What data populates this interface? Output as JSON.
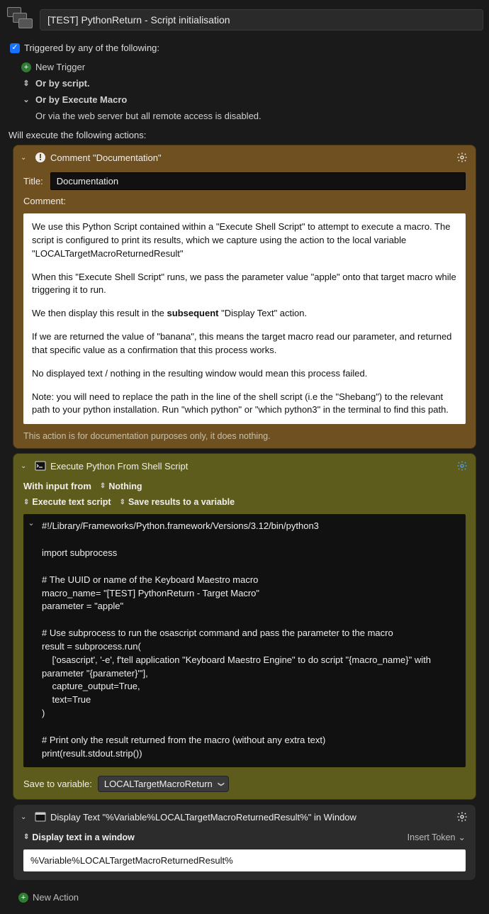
{
  "header": {
    "title": "[TEST] PythonReturn - Script initialisation"
  },
  "triggers": {
    "label": "Triggered by any of the following:",
    "new_trigger": "New Trigger",
    "or_script": "Or by script.",
    "or_execute_macro": "Or by Execute Macro",
    "or_web": "Or via the web server but all remote access is disabled."
  },
  "actions_label": "Will execute the following actions:",
  "comment_action": {
    "header": "Comment \"Documentation\"",
    "title_label": "Title:",
    "title_value": "Documentation",
    "comment_label": "Comment:",
    "p1": "We use this Python Script contained within a \"Execute Shell Script\" to attempt to execute a macro. The script is configured to print its results, which we capture using the action to the local variable \"LOCALTargetMacroReturnedResult\"",
    "p2": "When this \"Execute Shell Script\" runs, we pass the parameter value \"apple\" onto that target macro while triggering it to run.",
    "p3_a": "We then display this result in the ",
    "p3_b": "subsequent",
    "p3_c": " \"Display Text\" action.",
    "p4": "If we are returned the value of \"banana\", this means the target macro read our parameter, and returned that specific value as a confirmation that this process works.",
    "p5": "No displayed text / nothing in the resulting window would mean this process failed.",
    "p6": "Note: you will need to replace the path in the line of the shell script (i.e the \"Shebang\") to the relevant path to your python installation. Run \"which python\" or \"which python3\" in the terminal to find this path.",
    "footer_note": "This action is for documentation purposes only, it does nothing."
  },
  "exec_action": {
    "header": "Execute Python From Shell Script",
    "input_label": "With input from",
    "input_value": "Nothing",
    "opt_exec": "Execute text script",
    "opt_save": "Save results to a variable",
    "script": "#!/Library/Frameworks/Python.framework/Versions/3.12/bin/python3\n\nimport subprocess\n\n# The UUID or name of the Keyboard Maestro macro\nmacro_name= \"[TEST] PythonReturn - Target Macro\"\nparameter = \"apple\"\n\n# Use subprocess to run the osascript command and pass the parameter to the macro\nresult = subprocess.run(\n    ['osascript', '-e', f'tell application \"Keyboard Maestro Engine\" to do script \"{macro_name}\" with parameter \"{parameter}\"'],\n    capture_output=True,\n    text=True\n)\n\n# Print only the result returned from the macro (without any extra text)\nprint(result.stdout.strip())",
    "save_label": "Save to variable:",
    "save_var": "LOCALTargetMacroReturn"
  },
  "display_action": {
    "header": "Display Text \"%Variable%LOCALTargetMacroReturnedResult%\" in Window",
    "mode": "Display text in a window",
    "insert_token": "Insert Token",
    "text": "%Variable%LOCALTargetMacroReturnedResult%"
  },
  "new_action": "New Action"
}
